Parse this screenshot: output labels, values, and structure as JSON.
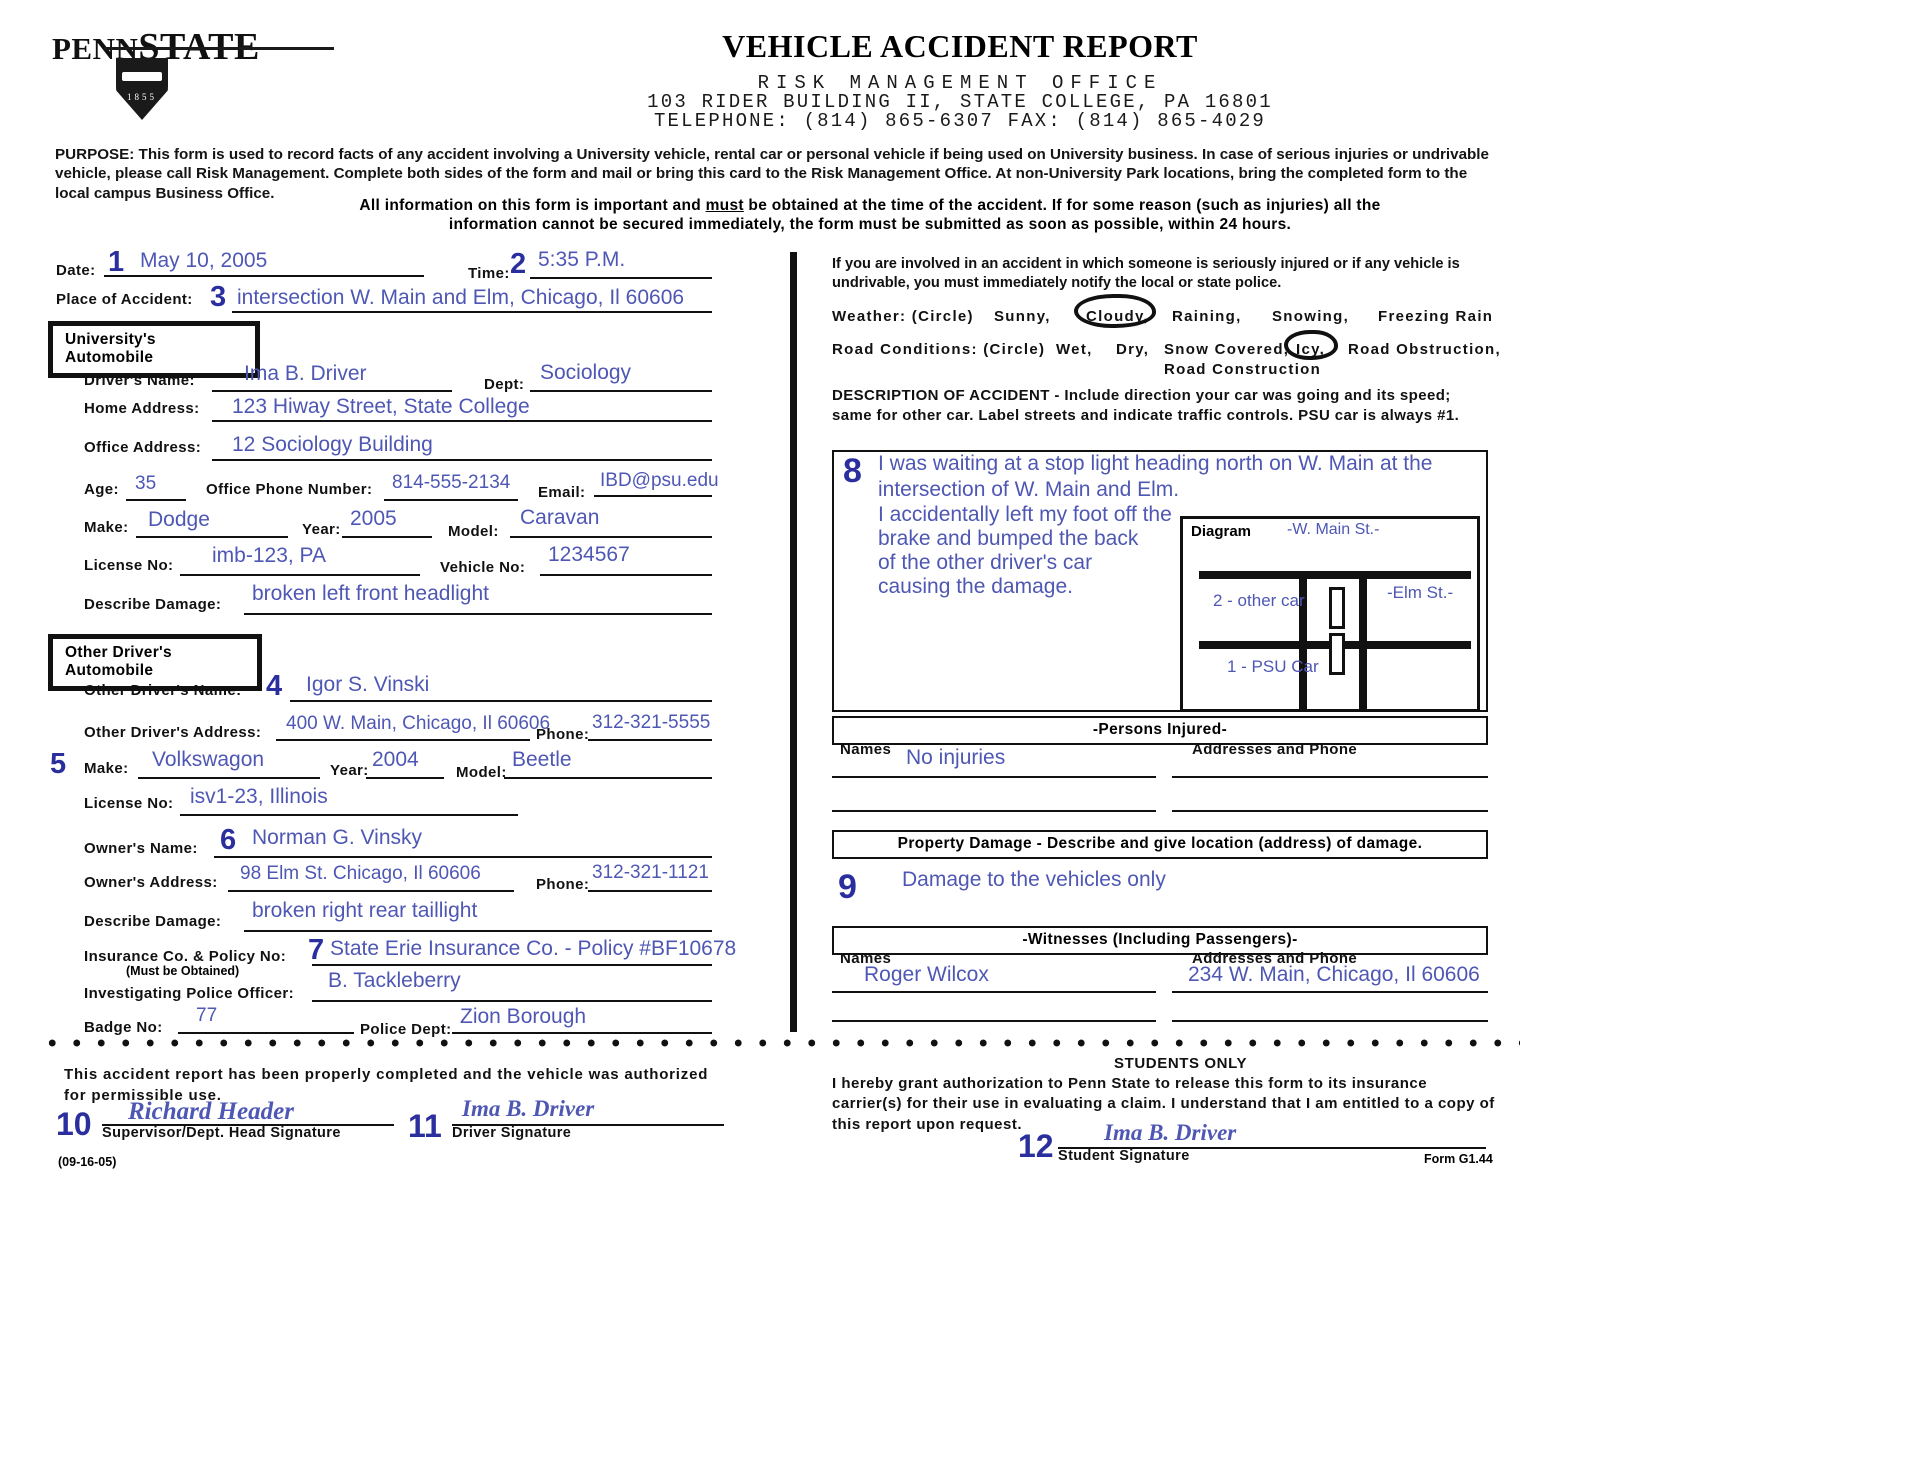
{
  "header": {
    "logo_primary": "PENN",
    "logo_secondary": "STATE",
    "shield_year": "1855",
    "title": "VEHICLE ACCIDENT REPORT",
    "office": "RISK   MANAGEMENT   OFFICE",
    "address": "103  RIDER  BUILDING  II,  STATE  COLLEGE,  PA    16801",
    "phone_line": "TELEPHONE:   (814)  865-6307  FAX:   (814)  865-4029"
  },
  "purpose": {
    "label": "PURPOSE:",
    "text": " This form is used to record facts of any accident involving a University vehicle, rental car or personal vehicle if being used on University business.  In case of serious injuries or undrivable vehicle, please call Risk Management.  Complete both sides of the form and mail or bring this card to the Risk Management Office.  At non-University Park locations, bring the completed form to the local campus Business Office."
  },
  "allinfo": {
    "line1_a": "All information on this form is important and ",
    "line1_must": "must",
    "line1_b": " be obtained at the time of the accident.  If for some reason (such as injuries) all the",
    "line2": "information cannot be secured immediately, the form must be submitted as soon as possible, within 24 hours."
  },
  "top_fields": {
    "date_label": "Date:",
    "date_num": "1",
    "date_value": "May 10, 2005",
    "time_label": "Time:",
    "time_num": "2",
    "time_value": "5:35 P.M.",
    "place_label": "Place of Accident:",
    "place_num": "3",
    "place_value": "intersection W. Main and Elm, Chicago, Il 60606"
  },
  "university_auto": {
    "section_title": "University's Automobile",
    "driver_name_label": "Driver's Name:",
    "driver_name_value": "Ima  B. Driver",
    "dept_label": "Dept:",
    "dept_value": "Sociology",
    "home_address_label": "Home  Address:",
    "home_address_value": "123 Hiway Street, State College",
    "office_address_label": "Office  Address:",
    "office_address_value": "12 Sociology Building",
    "age_label": "Age:",
    "age_value": "35",
    "office_phone_label": "Office Phone Number:",
    "office_phone_value": "814-555-2134",
    "email_label": "Email:",
    "email_value": "IBD@psu.edu",
    "make_label": "Make:",
    "make_value": "Dodge",
    "year_label": "Year:",
    "year_value": "2005",
    "model_label": "Model:",
    "model_value": "Caravan",
    "license_label": "License  No:",
    "license_value": "imb-123, PA",
    "vehicle_no_label": "Vehicle No:",
    "vehicle_no_value": "1234567",
    "damage_label": "Describe  Damage:",
    "damage_value": "broken left front headlight"
  },
  "other_auto": {
    "section_title": "Other Driver's Automobile",
    "driver_name_label": "Other  Driver's  Name:",
    "driver_name_num": "4",
    "driver_name_value": "Igor S. Vinski",
    "driver_address_label": "Other Driver's Address:",
    "driver_address_value": "400 W. Main, Chicago, Il 60606",
    "driver_phone_label": "Phone:",
    "driver_phone_value": "312-321-5555",
    "make_num": "5",
    "make_label": "Make:",
    "make_value": "Volkswagon",
    "year_label": "Year:",
    "year_value": "2004",
    "model_label": "Model:",
    "model_value": "Beetle",
    "license_label": "License  No:",
    "license_value": "isv1-23, Illinois",
    "owner_name_label": "Owner's  Name:",
    "owner_name_num": "6",
    "owner_name_value": "Norman  G. Vinsky",
    "owner_address_label": "Owner's Address:",
    "owner_address_value": "98 Elm St. Chicago, Il 60606",
    "owner_phone_label": "Phone:",
    "owner_phone_value": "312-321-1121",
    "damage_label": "Describe  Damage:",
    "damage_value": "broken right rear taillight",
    "insurance_label": "Insurance Co. & Policy No:",
    "insurance_sublabel": "(Must be Obtained)",
    "insurance_num": "7",
    "insurance_value": "State Erie  Insurance Co. - Policy #BF10678",
    "police_officer_label": "Investigating  Police  Officer:",
    "police_officer_value": "B. Tackleberry",
    "badge_label": "Badge  No:",
    "badge_value": "77",
    "police_dept_label": "Police  Dept:",
    "police_dept_value": "Zion Borough"
  },
  "right": {
    "notice": "If you are involved in an accident in which someone is seriously injured or if any vehicle is undrivable, you must immediately notify the local or state police.",
    "weather_label": "Weather:   (Circle)",
    "weather_options": [
      "Sunny,",
      "Cloudy,",
      "Raining,",
      "Snowing,",
      "Freezing Rain"
    ],
    "weather_selected": "Cloudy,",
    "road_label": "Road Conditions:  (Circle)",
    "road_options": [
      "Wet,",
      "Dry,",
      "Snow Covered,",
      "Icy,",
      "Road Obstruction,",
      "Road  Construction"
    ],
    "road_selected": "Icy,",
    "description_heading": "DESCRIPTION OF ACCIDENT - Include direction your car was going and its speed;  same   for other car.   Label  streets and  indicate traffic controls.  PSU car is always #1.",
    "description_num": "8",
    "description_lines": [
      "I was waiting at a stop light heading north on W. Main at the",
      "intersection of W. Main and Elm.",
      "I accidentally left my foot off the",
      "brake and bumped the back",
      "of the other driver's car",
      "causing the damage."
    ],
    "diagram_label": "Diagram",
    "diagram_street_top": "-W. Main St.-",
    "diagram_street_right": "-Elm St.-",
    "diagram_car2": "2 - other car",
    "diagram_car1": "1 - PSU Car",
    "persons_injured_header": "-Persons Injured-",
    "names_label": "Names",
    "names_value": "No injuries",
    "addresses_label": "Addresses and Phone",
    "property_damage_header": "Property Damage - Describe and give location (address) of damage.",
    "property_damage_num": "9",
    "property_damage_value": "Damage to the vehicles only",
    "witnesses_header": "-Witnesses   (Including  Passengers)-",
    "witness_names_label": "Names",
    "witness_name_value": "Roger  Wilcox",
    "witness_addr_label": "Addresses and Phone",
    "witness_addr_value": "234 W. Main, Chicago, Il 60606"
  },
  "footer": {
    "certify_line1": "This  accident  report  has  been  properly  completed  and  the  vehicle  was  authorized",
    "certify_line2": "for  permissible  use.",
    "supervisor_num": "10",
    "supervisor_signature": "Richard Header",
    "supervisor_label": "Supervisor/Dept. Head Signature",
    "driver_num": "11",
    "driver_signature": "Ima  B. Driver",
    "driver_label": "Driver   Signature",
    "form_rev": "(09-16-05)",
    "students_only": "STUDENTS ONLY",
    "students_text": "I hereby grant authorization to Penn State to release this form to its insurance carrier(s) for their use in evaluating a claim. I understand that I am entitled to a copy of this report upon request.",
    "student_num": "12",
    "student_signature": "Ima  B. Driver",
    "student_label": "Student  Signature",
    "form_id": "Form G1.44"
  },
  "colors": {
    "ink": "#4e57b4",
    "num": "#2b2f9e",
    "print": "#111111"
  }
}
